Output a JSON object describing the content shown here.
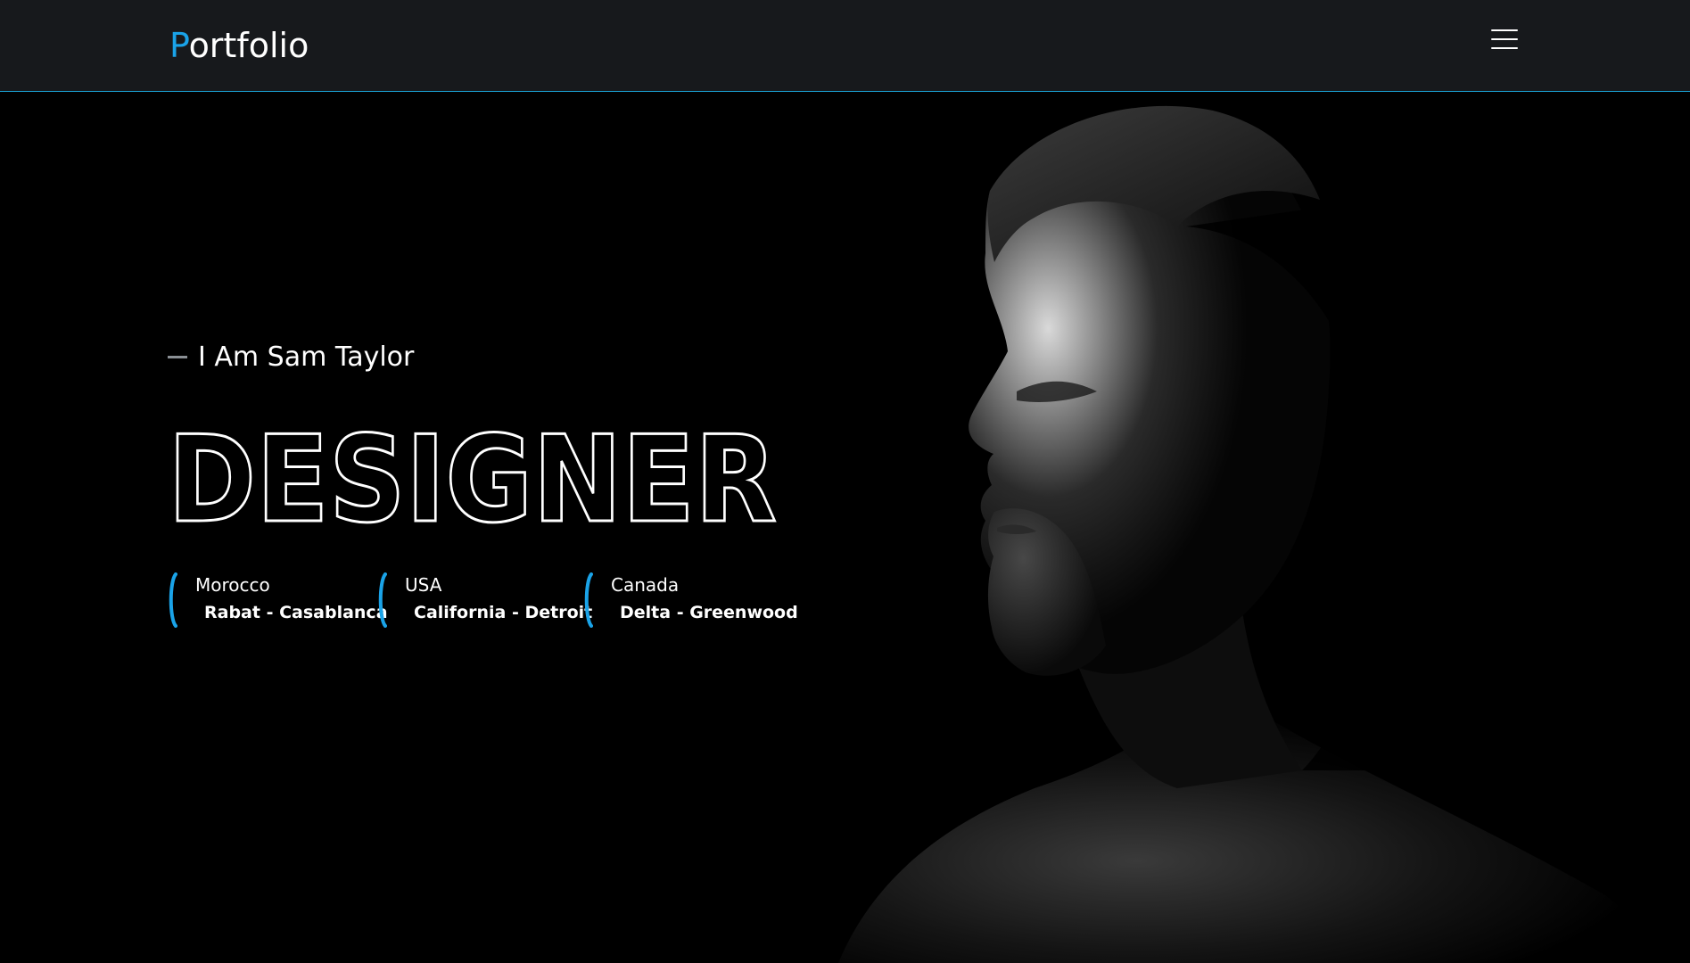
{
  "header": {
    "logo_first_letter": "P",
    "logo_rest": "ortfolio",
    "menu_icon": "hamburger-menu-icon"
  },
  "hero": {
    "intro": "I Am Sam Taylor",
    "headline": "DESIGNER",
    "locations": [
      {
        "country": "Morocco",
        "cities": "Rabat - Casablanca"
      },
      {
        "country": "USA",
        "cities": "California - Detroit"
      },
      {
        "country": "Canada",
        "cities": "Delta - Greenwood"
      }
    ]
  },
  "colors": {
    "accent": "#1aa3e8",
    "header_bg": "#17191c",
    "page_bg": "#000000",
    "text": "#ffffff"
  }
}
